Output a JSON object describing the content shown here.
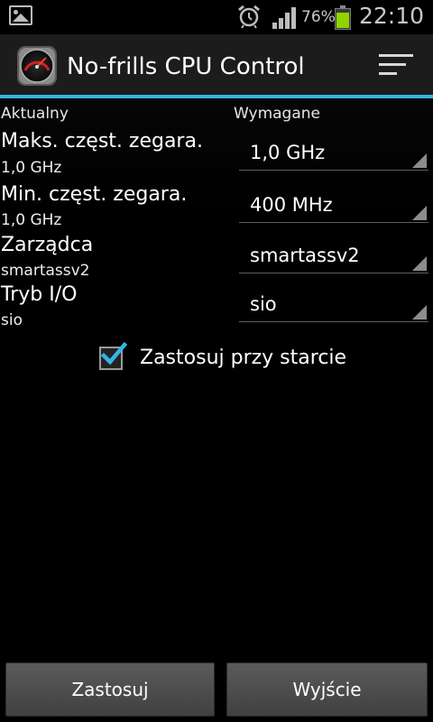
{
  "status_bar": {
    "battery_percent": "76%",
    "battery_level": 0.76,
    "time": "22:10",
    "icons": [
      "gallery-icon",
      "alarm-icon",
      "signal-icon",
      "battery-icon"
    ],
    "battery_color": "#8fd400"
  },
  "action_bar": {
    "title": "No-frills CPU Control",
    "icon": "speedometer-app-icon",
    "menu_icon": "sort-menu-icon",
    "accent_color": "#33b5e5"
  },
  "columns": {
    "current": "Aktualny",
    "required": "Wymagane"
  },
  "rows": [
    {
      "label": "Maks. częst. zegara.",
      "current": "1,0 GHz",
      "required": "1,0 GHz"
    },
    {
      "label": "Min. częst. zegara.",
      "current": "1,0 GHz",
      "required": "400 MHz"
    },
    {
      "label": "Zarządca",
      "current": "smartassv2",
      "required": "smartassv2"
    },
    {
      "label": "Tryb I/O",
      "current": "sio",
      "required": "sio"
    }
  ],
  "apply_on_boot": {
    "label": "Zastosuj przy starcie",
    "checked": true
  },
  "buttons": {
    "apply": "Zastosuj",
    "exit": "Wyjście"
  }
}
